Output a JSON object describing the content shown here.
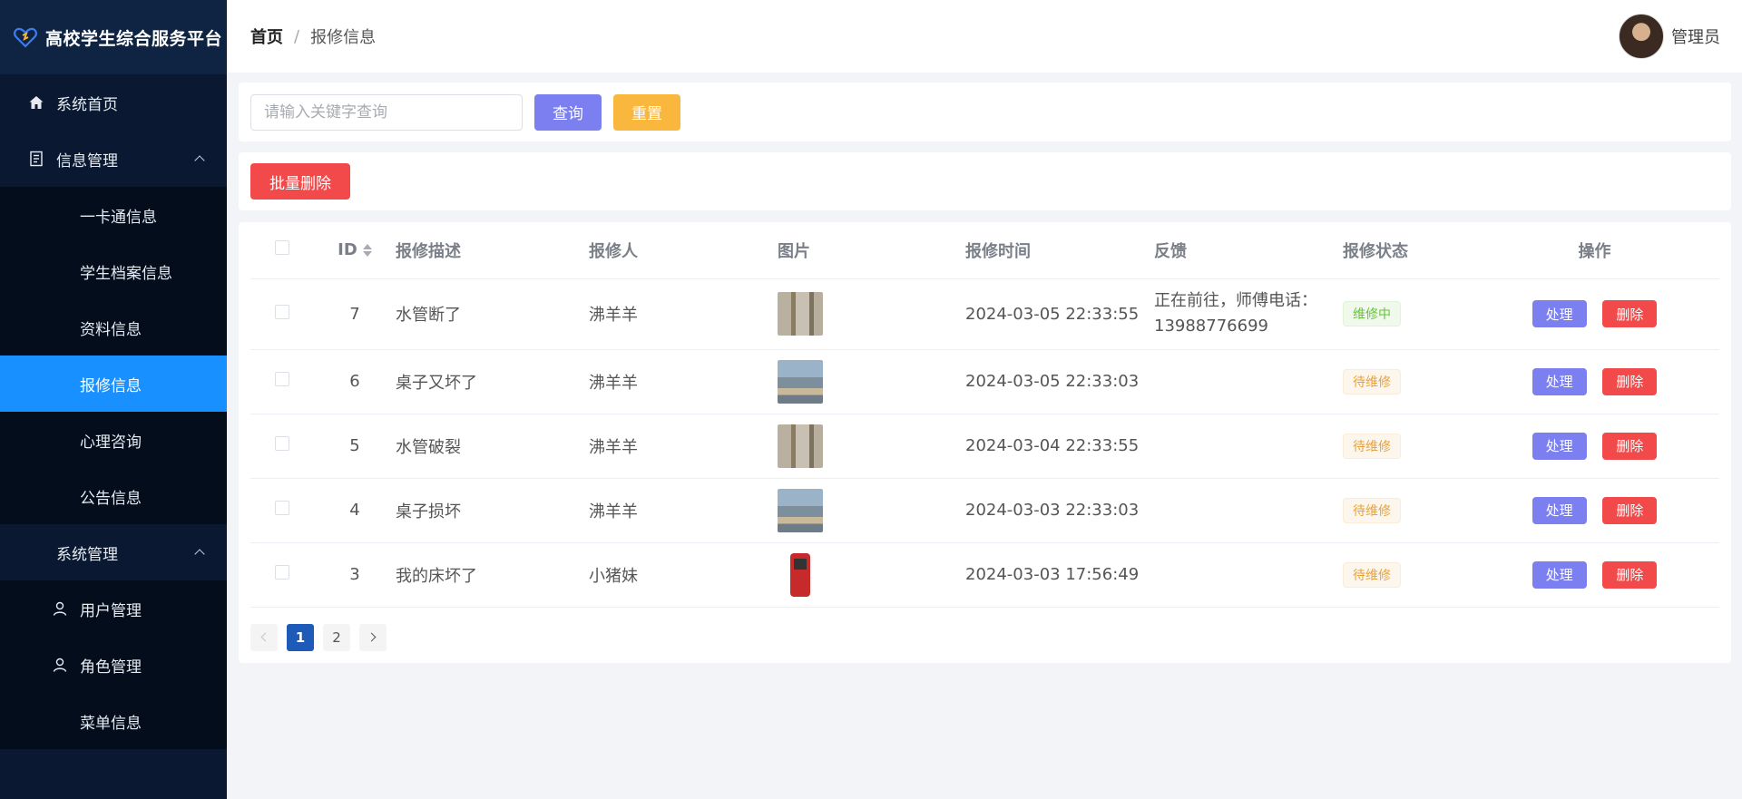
{
  "brand": {
    "title": "高校学生综合服务平台"
  },
  "sidebar": {
    "home": "系统首页",
    "info_mgmt": "信息管理",
    "info_items": [
      "一卡通信息",
      "学生档案信息",
      "资料信息",
      "报修信息",
      "心理咨询",
      "公告信息"
    ],
    "sys_mgmt": "系统管理",
    "sys_items": [
      "用户管理",
      "角色管理",
      "菜单信息"
    ],
    "active": "报修信息"
  },
  "header": {
    "breadcrumb_home": "首页",
    "breadcrumb_sep": "/",
    "breadcrumb_current": "报修信息",
    "user_name": "管理员"
  },
  "search": {
    "placeholder": "请输入关键字查询",
    "query_label": "查询",
    "reset_label": "重置"
  },
  "batch": {
    "delete_label": "批量删除"
  },
  "table": {
    "columns": [
      "ID",
      "报修描述",
      "报修人",
      "图片",
      "报修时间",
      "反馈",
      "报修状态",
      "操作"
    ],
    "rows": [
      {
        "id": "7",
        "desc": "水管断了",
        "reporter": "沸羊羊",
        "image": "pipe",
        "time": "2024-03-05 22:33:55",
        "feedback": "正在前往，师傅电话：13988776699",
        "status": "维修中"
      },
      {
        "id": "6",
        "desc": "桌子又坏了",
        "reporter": "沸羊羊",
        "image": "desk",
        "time": "2024-03-05 22:33:03",
        "feedback": "",
        "status": "待维修"
      },
      {
        "id": "5",
        "desc": "水管破裂",
        "reporter": "沸羊羊",
        "image": "pipe",
        "time": "2024-03-04 22:33:55",
        "feedback": "",
        "status": "待维修"
      },
      {
        "id": "4",
        "desc": "桌子损坏",
        "reporter": "沸羊羊",
        "image": "desk",
        "time": "2024-03-03 22:33:03",
        "feedback": "",
        "status": "待维修"
      },
      {
        "id": "3",
        "desc": "我的床坏了",
        "reporter": "小猪妹",
        "image": "meter",
        "time": "2024-03-03 17:56:49",
        "feedback": "",
        "status": "待维修"
      }
    ],
    "action_handle": "处理",
    "action_delete": "删除"
  },
  "pagination": {
    "pages": [
      "1",
      "2"
    ],
    "current": "1"
  },
  "colors": {
    "sidebar_bg": "#0a1931",
    "active_menu": "#1890ff",
    "primary_btn": "#7b7ff0",
    "reset_btn": "#f9b73e",
    "danger_btn": "#f24a4a"
  }
}
